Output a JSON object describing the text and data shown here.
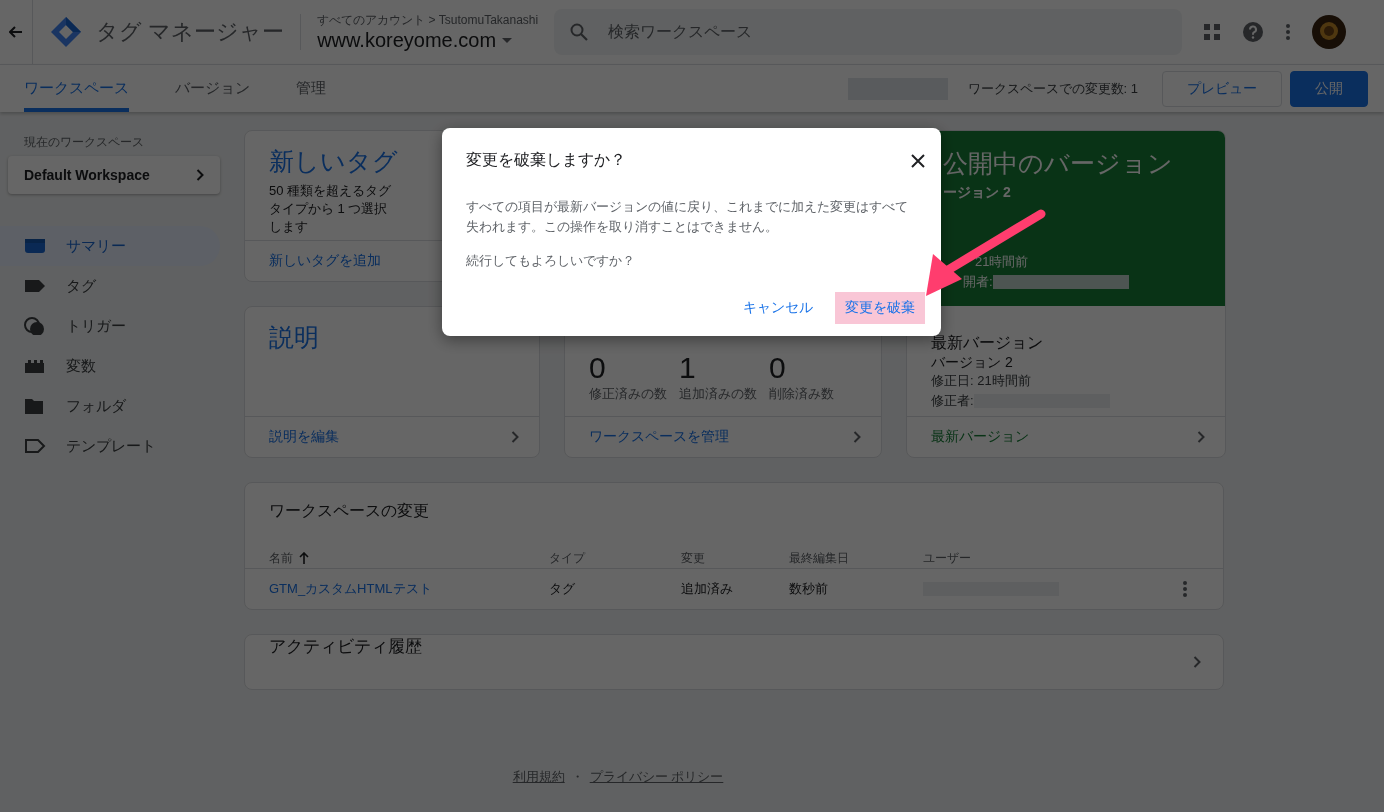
{
  "header": {
    "product": "タグ マネージャー",
    "breadcrumb": "すべてのアカウント > TsutomuTakanashi",
    "container": "www.koreyome.com",
    "search": {
      "placeholder": "検索ワークスペース"
    }
  },
  "tabs": [
    {
      "label": "ワークスペース",
      "selected": true
    },
    {
      "label": "バージョン",
      "selected": false
    },
    {
      "label": "管理",
      "selected": false
    }
  ],
  "changes_count": "ワークスペースでの変更数: 1",
  "actions": [
    {
      "label": "プレビュー",
      "kind": "outlined"
    },
    {
      "label": "公開",
      "kind": "filled"
    }
  ],
  "sidebar": {
    "workspace_label": "現在のワークスペース",
    "workspace": "Default Workspace",
    "items": [
      {
        "label": "サマリー",
        "selected": true
      },
      {
        "label": "タグ",
        "selected": false
      },
      {
        "label": "トリガー",
        "selected": false
      },
      {
        "label": "変数",
        "selected": false
      },
      {
        "label": "フォルダ",
        "selected": false
      },
      {
        "label": "テンプレート",
        "selected": false
      }
    ]
  },
  "new_tag": {
    "title": "新しいタグ",
    "description": "50 種類を超えるタグタイプから 1 つ選択します",
    "link": "新しいタグを追加"
  },
  "description_card": {
    "title": "説明",
    "link": "説明を編集"
  },
  "workspace_stats": {
    "stats": [
      {
        "value": "0",
        "label": "修正済みの数"
      },
      {
        "value": "1",
        "label": "追加済みの数"
      },
      {
        "value": "0",
        "label": "削除済み数"
      }
    ],
    "link": "ワークスペースを管理"
  },
  "live_version": {
    "title": "公開中のバージョン",
    "version": "ージョン 2",
    "date": "21時間前",
    "publisher": "開者:"
  },
  "latest_version": {
    "title": "最新バージョン",
    "version": "バージョン 2",
    "date": "修正日: 21時間前",
    "editor": "修正者:",
    "link": "最新バージョン"
  },
  "changes_table": {
    "title": "ワークスペースの変更",
    "columns": [
      {
        "label": "名前",
        "sorted": true
      },
      {
        "label": "タイプ",
        "sorted": false
      },
      {
        "label": "変更",
        "sorted": false
      },
      {
        "label": "最終編集日",
        "sorted": false
      },
      {
        "label": "ユーザー",
        "sorted": false
      }
    ],
    "rows": [
      {
        "name": "GTM_カスタムHTMLテスト",
        "type": "タグ",
        "change": "追加済み",
        "date": "数秒前"
      }
    ]
  },
  "activity": {
    "title": "アクティビティ履歴"
  },
  "footer": {
    "links": [
      "利用規約",
      "プライバシー ポリシー"
    ],
    "separator": "・"
  },
  "dialog": {
    "title": "変更を破棄しますか？",
    "body": "すべての項目が最新バージョンの値に戻り、これまでに加えた変更はすべて失われます。この操作を取り消すことはできません。",
    "question": "続行してもよろしいですか？",
    "buttons": [
      {
        "label": "キャンセル",
        "kind": "text"
      },
      {
        "label": "変更を破棄",
        "kind": "highlighted"
      }
    ]
  }
}
